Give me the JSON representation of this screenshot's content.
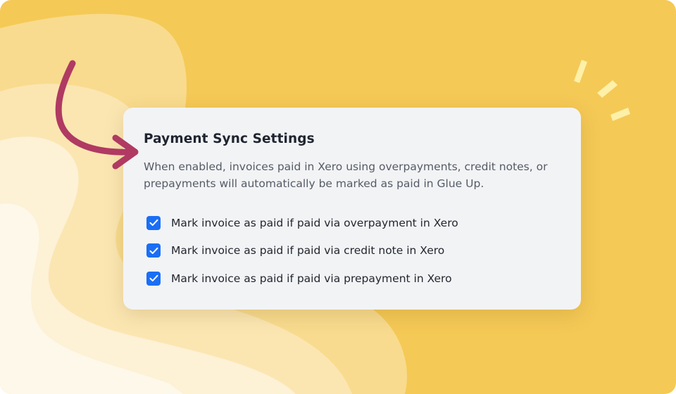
{
  "settings": {
    "title": "Payment Sync Settings",
    "description": "When enabled, invoices paid in Xero using overpayments, credit notes, or prepayments will automatically be marked as paid in Glue Up.",
    "options": [
      {
        "label": "Mark invoice as paid if paid via overpayment in Xero",
        "checked": true
      },
      {
        "label": "Mark invoice as paid if paid via credit note in Xero",
        "checked": true
      },
      {
        "label": "Mark invoice as paid if paid via prepayment in Xero",
        "checked": true
      }
    ]
  },
  "colors": {
    "background": "#f5c956",
    "checkbox": "#1a6ef5",
    "arrow": "#b03a62",
    "sparkle": "#fdf0a8"
  },
  "icons": [
    "checkmark-icon",
    "curved-arrow-icon",
    "sparkle-icon"
  ]
}
